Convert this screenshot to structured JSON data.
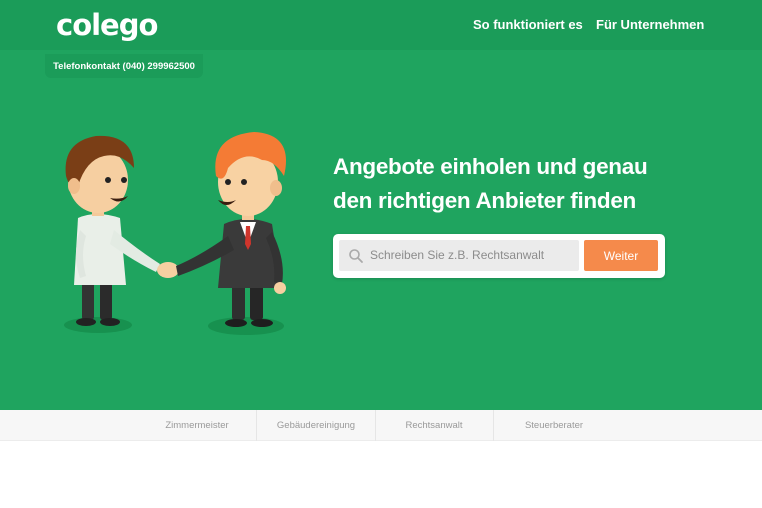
{
  "brand": {
    "logo_text": "colego"
  },
  "nav": {
    "how_it_works": "So funktioniert es",
    "for_companies": "Für Unternehmen"
  },
  "contact": {
    "phone_label": "Telefonkontakt (040) 299962500"
  },
  "hero": {
    "headline_line1": "Angebote einholen und genau",
    "headline_line2": "den richtigen Anbieter finden"
  },
  "search": {
    "placeholder": "Schreiben Sie z.B. Rechtsanwalt",
    "submit_label": "Weiter",
    "icon": "search-icon"
  },
  "categories": [
    "Zimmermeister",
    "Gebäudereinigung",
    "Rechtsanwalt",
    "Steuerberater"
  ],
  "colors": {
    "hero_green": "#1fa45f",
    "header_green": "#1b9c59",
    "accent_orange": "#f58a4b"
  }
}
